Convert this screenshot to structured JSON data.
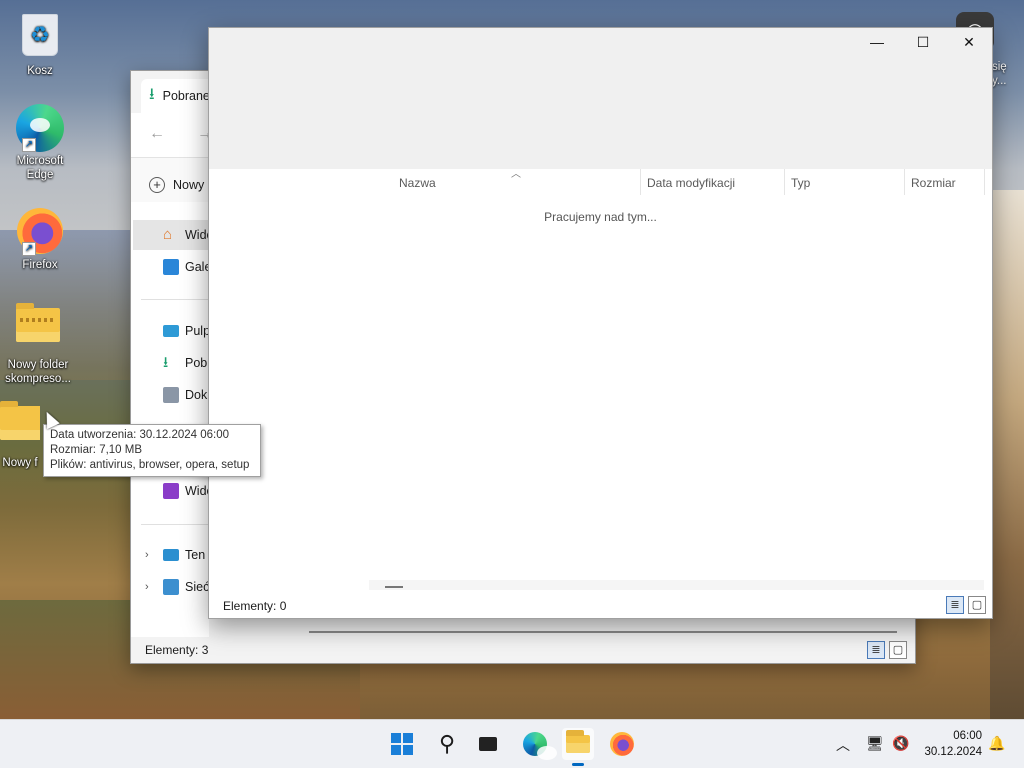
{
  "desktop": {
    "icons": [
      {
        "label": "Kosz",
        "icon": "recycle-bin-icon"
      },
      {
        "label": "Microsoft Edge",
        "icon": "edge-icon"
      },
      {
        "label": "Firefox",
        "icon": "firefox-icon"
      },
      {
        "label": "Nowy folder skompreso...",
        "icon": "zip-folder-icon"
      },
      {
        "label": "Nowy f",
        "icon": "folder-icon"
      }
    ],
    "top_right_text_1": "się",
    "top_right_text_2": "y..."
  },
  "back_window": {
    "tab_title": "Pobrane",
    "new_button": "Nowy",
    "nav_items": [
      {
        "label": "Widok główny",
        "icon": "home-icon",
        "selected": true
      },
      {
        "label": "Galeria",
        "icon": "gallery-icon"
      },
      {
        "label": "Pulpit",
        "icon": "desktop-icon"
      },
      {
        "label": "Pobrane",
        "icon": "download-icon"
      },
      {
        "label": "Dokumenty",
        "icon": "document-icon"
      },
      {
        "label": "Wideo",
        "icon": "video-icon"
      },
      {
        "label": "Ten komputer",
        "icon": "computer-icon"
      },
      {
        "label": "Sieć",
        "icon": "network-icon"
      }
    ],
    "status": "Elementy: 3"
  },
  "front_window": {
    "columns": [
      "Nazwa",
      "Data modyfikacji",
      "Typ",
      "Rozmiar"
    ],
    "working_text": "Pracujemy nad tym...",
    "status": "Elementy: 0"
  },
  "tooltip": {
    "line1": "Data utworzenia: 30.12.2024 06:00",
    "line2": "Rozmiar: 7,10 MB",
    "line3": "Plików: antivirus, browser, opera, setup"
  },
  "taskbar": {
    "apps": [
      "start-icon",
      "search-icon",
      "task-view-icon",
      "edge-icon",
      "file-explorer-icon",
      "firefox-icon"
    ],
    "time": "06:00",
    "date": "30.12.2024"
  },
  "colors": {
    "accent": "#0067c0",
    "folder": "#f4c446"
  }
}
